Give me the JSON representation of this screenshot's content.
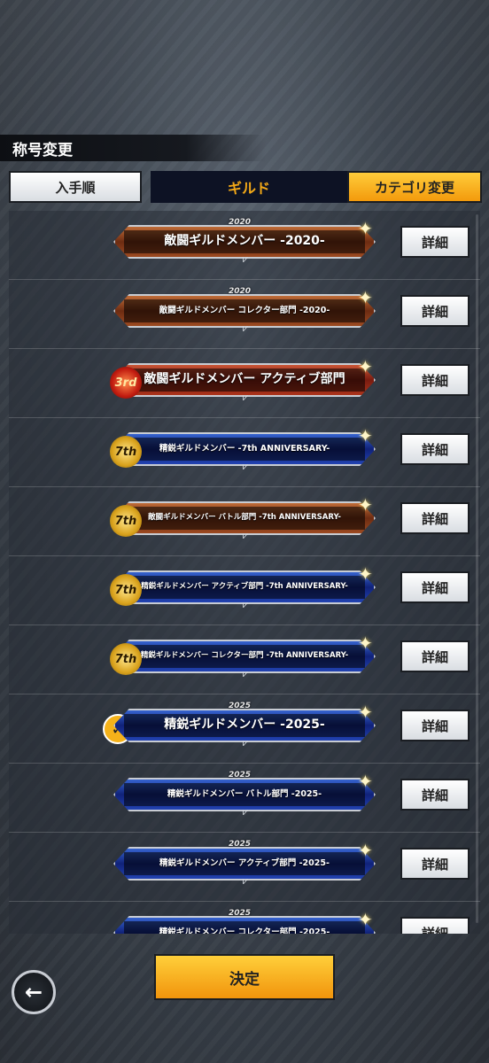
{
  "header": {
    "title": "称号変更"
  },
  "tabs": {
    "sort_label": "入手順",
    "active_category": "ギルド",
    "category_change_label": "カテゴリ変更"
  },
  "detail_label": "詳細",
  "titles": [
    {
      "text": "敵闘ギルドメンバー -2020-",
      "year": "2020",
      "style": "bronze",
      "size": "lg",
      "emblem": ""
    },
    {
      "text": "敵闘ギルドメンバー コレクター部門 -2020-",
      "year": "2020",
      "style": "bronze",
      "size": "sm",
      "emblem": ""
    },
    {
      "text": "敵闘ギルドメンバー アクティブ部門",
      "year": "",
      "style": "red",
      "size": "lg",
      "emblem": "3rd"
    },
    {
      "text": "精鋭ギルドメンバー -7th ANNIVERSARY-",
      "year": "",
      "style": "blue",
      "size": "sm",
      "emblem": "7th"
    },
    {
      "text": "敵闘ギルドメンバー バトル部門 -7th ANNIVERSARY-",
      "year": "",
      "style": "bronze",
      "size": "xs",
      "emblem": "7th"
    },
    {
      "text": "精鋭ギルドメンバー アクティブ部門 -7th ANNIVERSARY-",
      "year": "",
      "style": "blue",
      "size": "xs",
      "emblem": "7th"
    },
    {
      "text": "精鋭ギルドメンバー コレクター部門 -7th ANNIVERSARY-",
      "year": "",
      "style": "blue",
      "size": "xs",
      "emblem": "7th"
    },
    {
      "text": "精鋭ギルドメンバー -2025-",
      "year": "2025",
      "style": "blue",
      "size": "lg",
      "emblem": "",
      "selected": true
    },
    {
      "text": "精鋭ギルドメンバー バトル部門 -2025-",
      "year": "2025",
      "style": "blue",
      "size": "sm",
      "emblem": ""
    },
    {
      "text": "精鋭ギルドメンバー アクティブ部門 -2025-",
      "year": "2025",
      "style": "blue",
      "size": "sm",
      "emblem": ""
    },
    {
      "text": "精鋭ギルドメンバー コレクター部門 -2025-",
      "year": "2025",
      "style": "blue",
      "size": "sm",
      "emblem": ""
    }
  ],
  "footer": {
    "confirm_label": "決定"
  },
  "icons": {
    "back": "back-arrow-icon",
    "selected": "check-icon",
    "sparkle": "sparkle-icon"
  }
}
